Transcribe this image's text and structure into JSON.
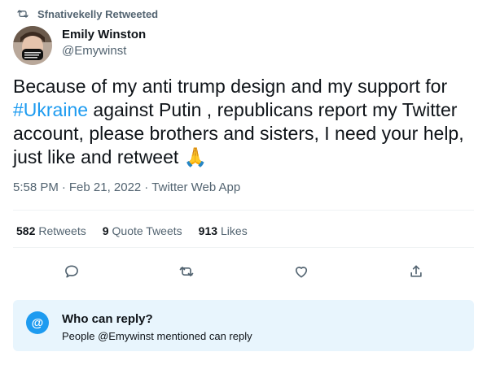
{
  "retweet_context": {
    "label": "Sfnativekelly Retweeted",
    "icon": "retweet-icon"
  },
  "author": {
    "name": "Emily Winston",
    "handle": "@Emywinst"
  },
  "tweet": {
    "text_before": "Because of my anti trump design and my support for ",
    "hashtag": "#Ukraine",
    "text_after": " against Putin , republicans report my Twitter account, please brothers and sisters, I need your help, just like and retweet ",
    "emoji": "🙏"
  },
  "meta": {
    "time": "5:58 PM",
    "dot1": "·",
    "date": "Feb 21, 2022",
    "dot2": "·",
    "source": "Twitter Web App"
  },
  "stats": [
    {
      "num": "582",
      "label": "Retweets"
    },
    {
      "num": "9",
      "label": "Quote Tweets"
    },
    {
      "num": "913",
      "label": "Likes"
    }
  ],
  "actions": [
    "reply-icon",
    "retweet-icon",
    "like-icon",
    "share-icon"
  ],
  "reply_restriction": {
    "icon_text": "@",
    "title": "Who can reply?",
    "subtitle": "People @Emywinst mentioned can reply"
  },
  "colors": {
    "accent": "#1d9bf0",
    "muted": "#536471",
    "reply_box_bg": "#e8f5fd"
  }
}
